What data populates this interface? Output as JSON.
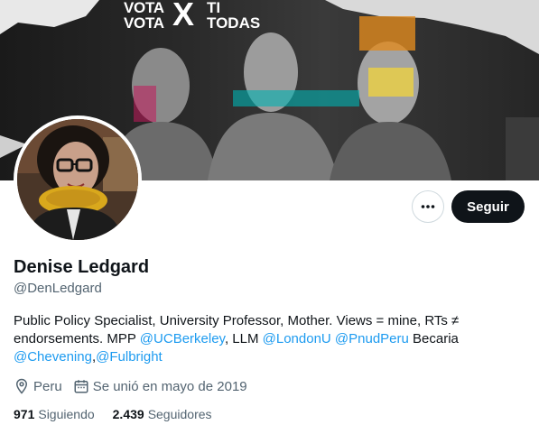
{
  "banner": {
    "line1_left": "VOTA",
    "line2_left": "VOTA",
    "x_mark": "X",
    "line1_right": "TI",
    "line2_right": "TODAS"
  },
  "profile": {
    "display_name": "Denise Ledgard",
    "handle": "@DenLedgard",
    "follow_label": "Seguir",
    "more_icon": "ellipsis-icon"
  },
  "bio": {
    "part1": "Public Policy Specialist, University Professor, Mother. Views = mine, RTs ≠ endorsements. MPP ",
    "mention1": "@UCBerkeley",
    "part2": ",  LLM ",
    "mention2": "@LondonU",
    "part3": " ",
    "mention3": "@PnudPeru",
    "part4": " Becaria ",
    "mention4": "@Chevening",
    "part5": ",",
    "mention5": "@Fulbright"
  },
  "meta": {
    "location_icon": "location-pin-icon",
    "location": "Peru",
    "joined_icon": "calendar-icon",
    "joined": "Se unió en mayo de 2019"
  },
  "stats": {
    "following_count": "971",
    "following_label": "Siguiendo",
    "followers_count": "2.439",
    "followers_label": "Seguidores"
  },
  "colors": {
    "accent": "#1d9bf0",
    "text_primary": "#0f1419",
    "text_secondary": "#536471",
    "follow_bg": "#0f1419"
  }
}
